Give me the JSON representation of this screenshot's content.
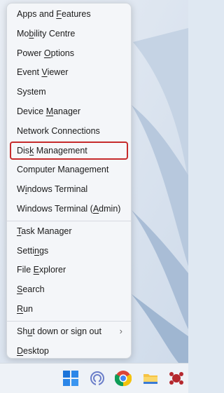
{
  "menu": {
    "groups": [
      [
        {
          "label": "Apps and Features",
          "access": "F"
        },
        {
          "label": "Mobility Centre",
          "access": "b"
        },
        {
          "label": "Power Options",
          "access": "O"
        },
        {
          "label": "Event Viewer",
          "access": "V"
        },
        {
          "label": "System",
          "access": "Y"
        },
        {
          "label": "Device Manager",
          "access": "M"
        },
        {
          "label": "Network Connections",
          "access": "W"
        },
        {
          "label": "Disk Management",
          "access": "k",
          "selected": true
        },
        {
          "label": "Computer Management",
          "access": "G"
        },
        {
          "label": "Windows Terminal",
          "access": "i"
        },
        {
          "label": "Windows Terminal (Admin)",
          "access": "A"
        }
      ],
      [
        {
          "label": "Task Manager",
          "access": "T"
        },
        {
          "label": "Settings",
          "access": "n"
        },
        {
          "label": "File Explorer",
          "access": "E"
        },
        {
          "label": "Search",
          "access": "S"
        },
        {
          "label": "Run",
          "access": "R"
        }
      ],
      [
        {
          "label": "Shut down or sign out",
          "access": "u",
          "submenu": true
        },
        {
          "label": "Desktop",
          "access": "D"
        }
      ]
    ]
  },
  "taskbar": {
    "icons": [
      "windows-start-icon",
      "cortana-icon",
      "chrome-icon",
      "file-explorer-icon",
      "app-icon"
    ]
  },
  "colors": {
    "highlight_border": "#c62b2b",
    "menu_bg": "#f4f6f9"
  }
}
